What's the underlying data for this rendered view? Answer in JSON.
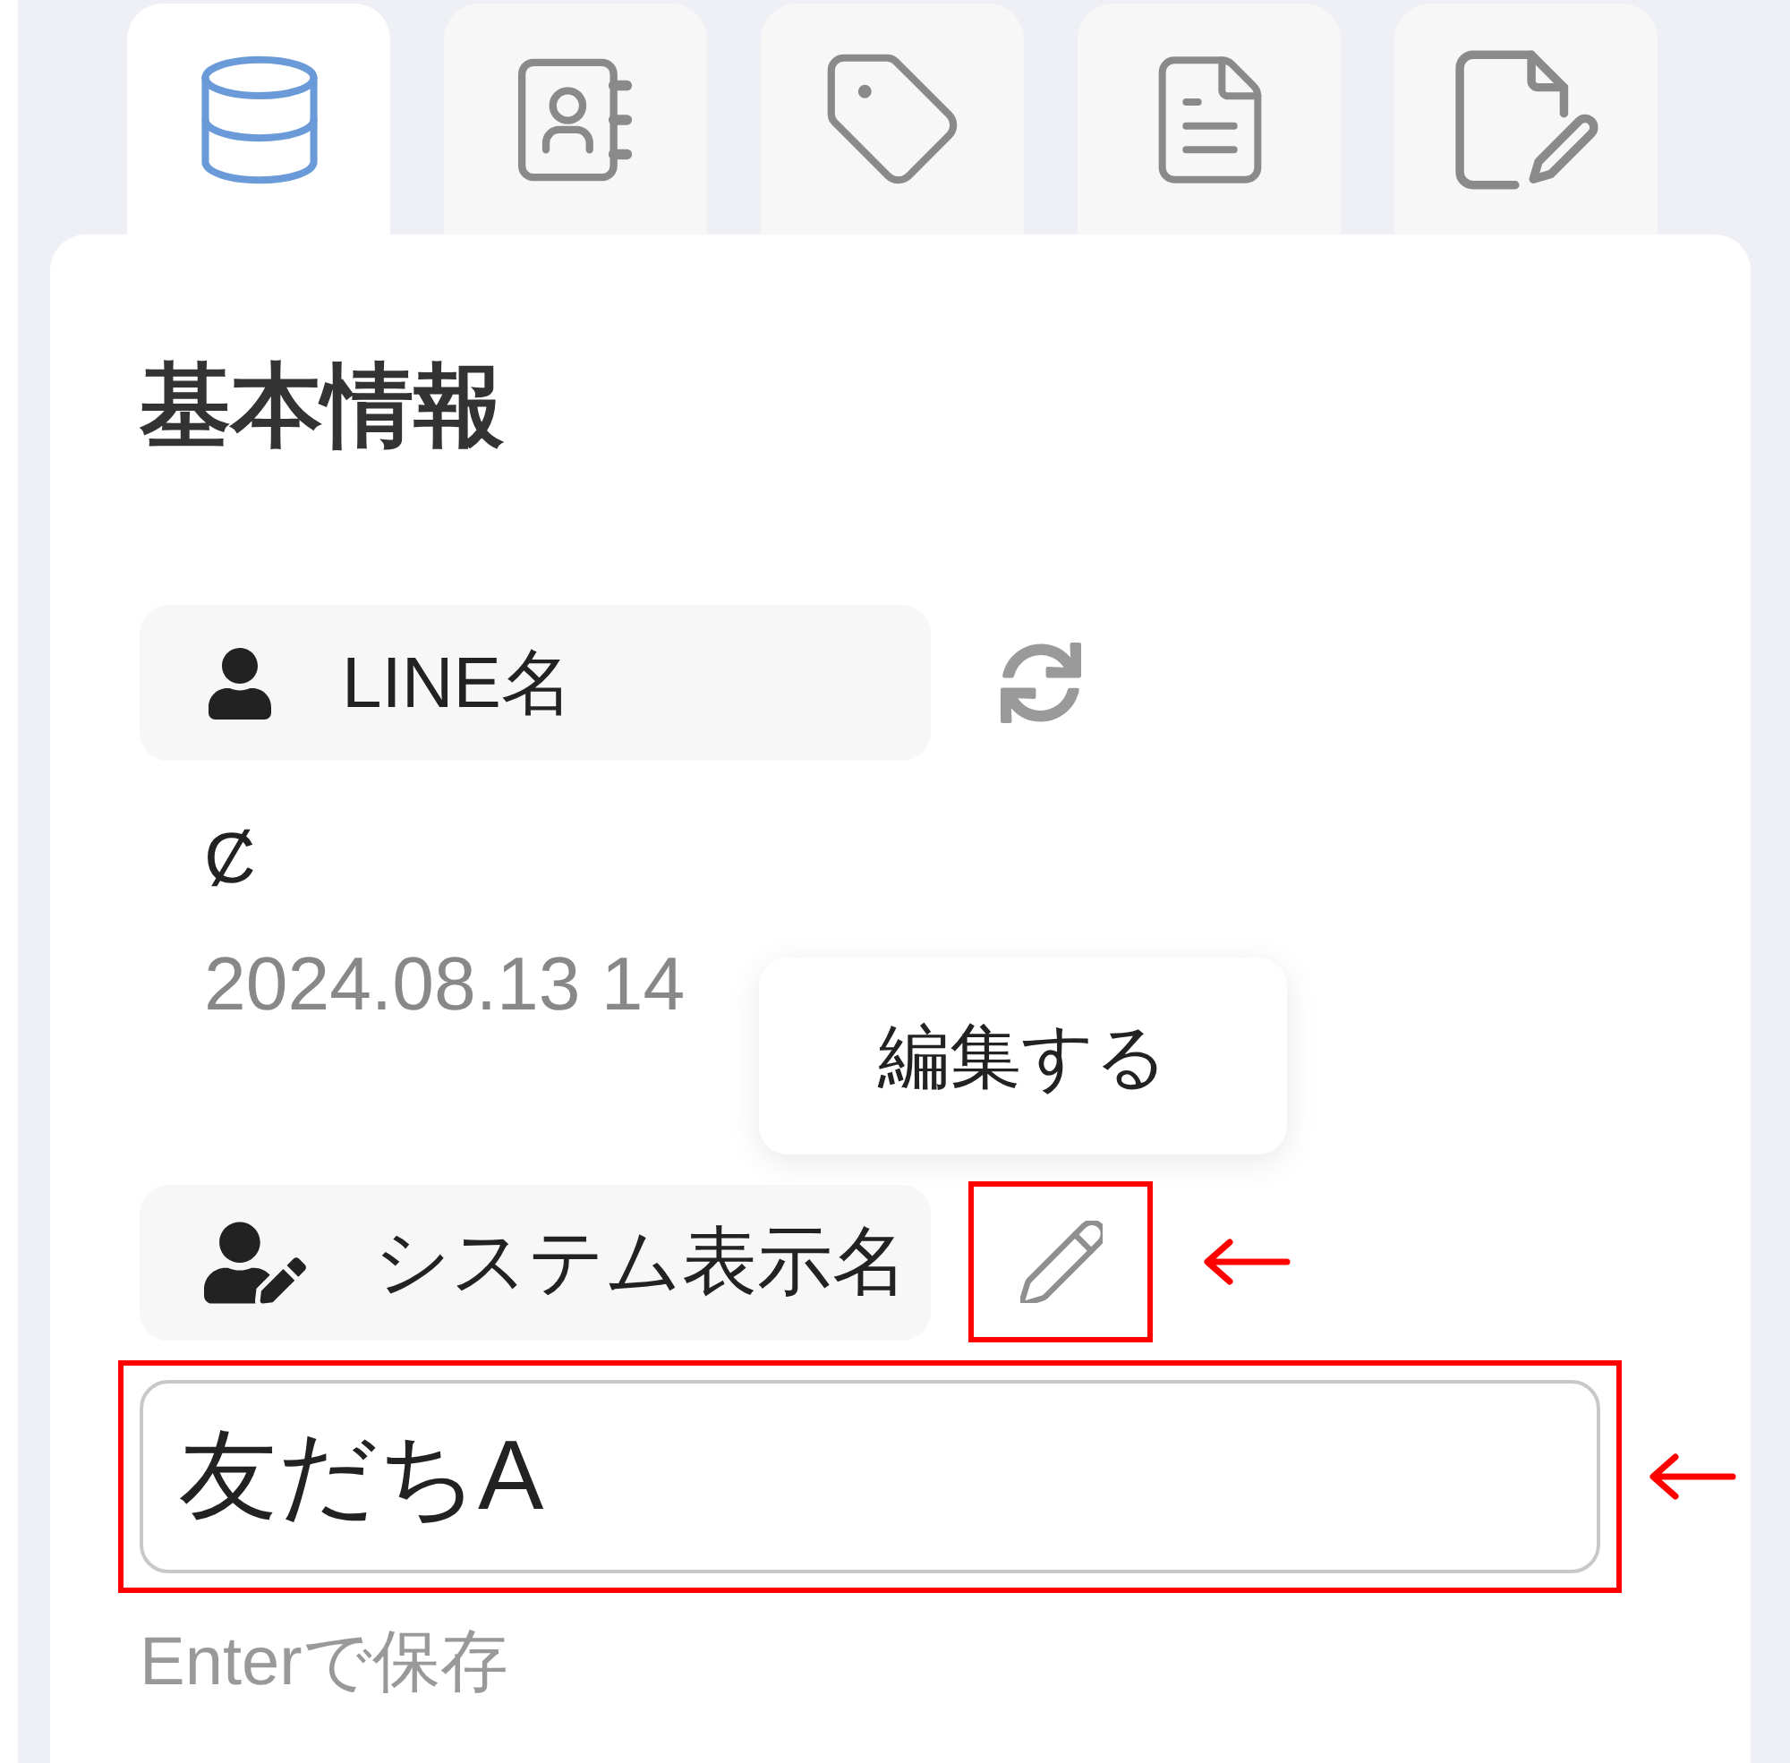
{
  "tabs": [
    {
      "kind": "database",
      "selected": true
    },
    {
      "kind": "contacts",
      "selected": false
    },
    {
      "kind": "tag",
      "selected": false
    },
    {
      "kind": "document",
      "selected": false
    },
    {
      "kind": "document-edit",
      "selected": false
    }
  ],
  "section": {
    "title": "基本情報"
  },
  "line_name": {
    "label": "LINE名",
    "value": "Ȼ",
    "date": "2024.08.13 14"
  },
  "system_name": {
    "label": "システム表示名",
    "tooltip": "編集する",
    "edit_button": {
      "highlighted": true
    },
    "input": {
      "value": "友だちA",
      "highlighted": true
    },
    "hint": "Enterで保存"
  }
}
